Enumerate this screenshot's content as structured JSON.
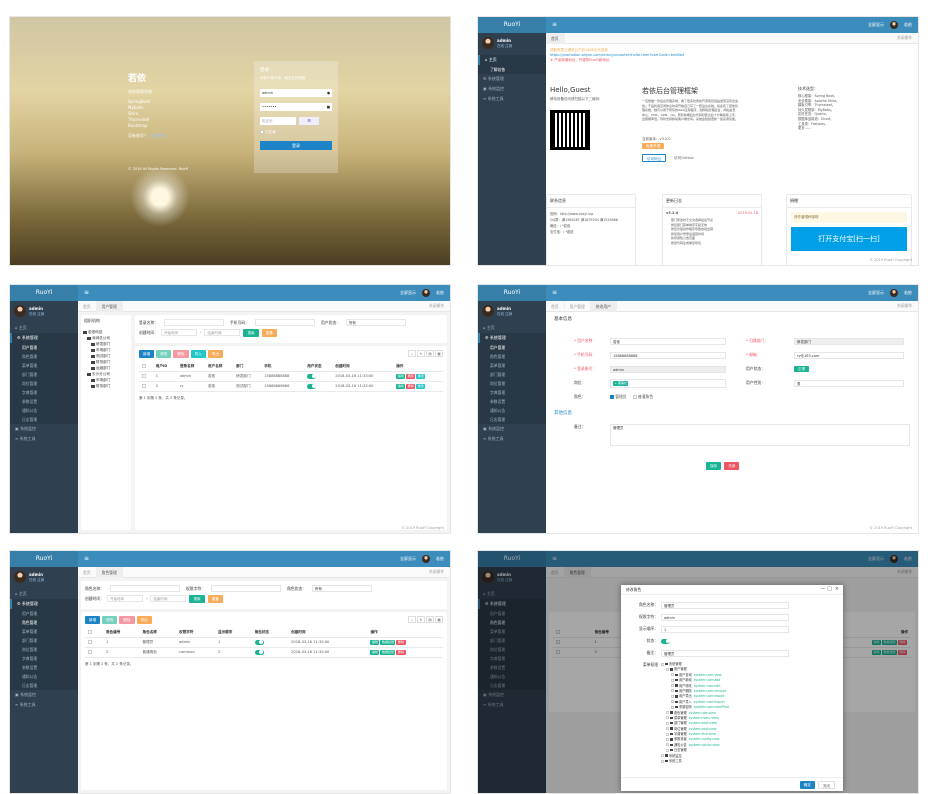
{
  "login": {
    "brand": "若依",
    "slogan": "若依管理系统",
    "features": [
      "SpringBoot",
      "Mybatis",
      "Shiro",
      "Thymeleaf",
      "Bootstrap"
    ],
    "register_hint": "没有账号？",
    "register_link": "立即注册",
    "login_title": "登录：",
    "login_subtitle": "你若不离不弃，我必生死相依",
    "username": "admin",
    "password": "•••••••",
    "captcha_placeholder": "验证码",
    "remember": "记住我",
    "login_button": "登录",
    "copyright": "© 2019 All Rights Reserved. RuoYi"
  },
  "common": {
    "logo": "RuoYi",
    "user": "admin",
    "online": "在线",
    "logout": "注销",
    "fullscreen": "全屏显示",
    "personal_center": "若依",
    "home_tab": "首页",
    "tab_actions": "关闭操作",
    "refresh": "刷新",
    "copyright": "© 2019 RuoYi Copyright",
    "menu_system": "系统管理",
    "menu_monitor": "系统监控",
    "menu_tool": "系统工具",
    "menu_home": "主页",
    "system_sub": [
      "用户管理",
      "角色管理",
      "菜单管理",
      "部门管理",
      "岗位管理",
      "字典管理",
      "参数设置",
      "通知公告",
      "日志管理"
    ]
  },
  "dashboard": {
    "menu_home_sub": "了解若依",
    "notice_line1": "领取阿里云通用云产品1888元代金券",
    "notice_line2": "https://promotion.aliyun.com/ntms/yunparter/invite.html?userCode=brki8iof",
    "notice_line3": "★ 产品新增地址，开源的RuoYi新地址",
    "hello": "Hello,Guest",
    "hello_sub": "移动设备访问请扫描以下二维码：",
    "title": "若依后台管理框架",
    "desc": "一直想做一款后台管理系统，看了很多优秀的开源项目但是发现没有合适的。于是利用空闲休息时间开始自己写了一套后台系统。如此有了若依管理系统，她可以用于所有的Web应用程序，如网站管理后台，网站会员中心，CMS，CRM，OA。所有前端后台代码封装过后十分精简易上手，出错概率低。同时支持移动客户端访问。系统会陆续更新一些实用功能。",
    "version_label": "当前版本：v3.2.0",
    "free_badge": "免费开源",
    "btn_cloud": "访问码云",
    "btn_github": "访问GitHub",
    "tech_title": "技术选型：",
    "tech": [
      "核心框架：Spring Boot。",
      "安全框架：Apache Shiro。",
      "模板引擎：Thymeleaf。",
      "持久层框架：MyBatis。",
      "定时任务：Quartz。",
      "数据库连接池：Druid。",
      "工具类：Fastjson。",
      "更多……"
    ],
    "contact_title": "联系信息",
    "contact": [
      "官网：http://www.ruoyi.vip",
      "QQ群：满1389287 满1679294 满1529866",
      "微信：/ *若依",
      "支付宝：/ *若依"
    ],
    "log_title": "更新日志",
    "log_version": "v3.2.0",
    "log_date": "2019.01.18",
    "log_items": [
      "部门修改时不允许选择最后节点",
      "修复部门菜单排序字段无效",
      "修复光驱动作程序导致启动出错",
      "修复用户登录后返回时间",
      "新增通知公告页面",
      "修复代码生成重复导包"
    ],
    "donate_title": "捐赠",
    "donate_hint": "请作者喝杯咖啡",
    "alipay": "打开支付宝[扫一扫]"
  },
  "user_list": {
    "tab": "用户管理",
    "tree_title": "组织机构",
    "tree": [
      "若依科技",
      "深圳总公司",
      "研发部门",
      "市场部门",
      "测试部门",
      "财务部门",
      "运维部门",
      "长沙分公司",
      "市场部门",
      "财务部门"
    ],
    "f_login": "登录名称：",
    "f_phone": "手机号码：",
    "f_status": "用户状态：",
    "f_status_val": "所有",
    "f_time": "创建时间：",
    "start_ph": "开始时间",
    "end_ph": "结束时间",
    "search": "搜索",
    "reset": "重置",
    "add": "新增",
    "edit": "修改",
    "delete": "删除",
    "import": "导入",
    "export": "导出",
    "columns": [
      "用户ID",
      "登录名称",
      "用户名称",
      "部门",
      "手机",
      "用户状态",
      "创建时间",
      "操作"
    ],
    "rows": [
      {
        "id": "1",
        "login": "admin",
        "name": "若依",
        "dept": "研发部门",
        "phone": "15888888888",
        "time": "2018-03-16 11:33:00"
      },
      {
        "id": "2",
        "login": "ry",
        "name": "若依",
        "dept": "测试部门",
        "phone": "15666666666",
        "time": "2018-03-16 11:33:00"
      }
    ],
    "row_actions": [
      "编辑",
      "删除",
      "重置"
    ],
    "pager": "第 1 到第 2 条，共 2 条记录。"
  },
  "user_edit": {
    "tab1": "用户管理",
    "tab2": "修改用户",
    "section1": "基本信息",
    "section2": "其他信息",
    "nickname_l": "* 用户名称：",
    "nickname": "若依",
    "dept_l": "* 归属部门：",
    "dept": "研发部门",
    "phone_l": "* 手机号码：",
    "phone": "15888888888",
    "email_l": "* 邮箱：",
    "email": "ry@163.com",
    "login_l": "* 登录账号：",
    "login": "admin",
    "status_l": "用户状态：",
    "status": "正常",
    "post_l": "岗位：",
    "post_btn": "+ 董事长",
    "sex_l": "用户性别：",
    "sex": "男",
    "role_l": "角色：",
    "roles": [
      "管理员",
      "普通角色"
    ],
    "remark_l": "备注：",
    "remark": "管理员",
    "save": "保存",
    "close": "关闭"
  },
  "role_list": {
    "tab": "角色管理",
    "f_name": "角色名称：",
    "f_key": "权限字符：",
    "f_status": "角色状态：",
    "f_status_val": "所有",
    "f_time": "创建时间：",
    "start_ph": "开始时间",
    "end_ph": "结束时间",
    "search": "搜索",
    "reset": "重置",
    "add": "新增",
    "edit": "修改",
    "delete": "删除",
    "export": "导出",
    "columns": [
      "角色编号",
      "角色名称",
      "权限字符",
      "显示顺序",
      "角色状态",
      "创建时间",
      "操作"
    ],
    "rows": [
      {
        "id": "1",
        "name": "管理员",
        "key": "admin",
        "sort": "1",
        "time": "2018-03-16 11:33:00"
      },
      {
        "id": "2",
        "name": "普通角色",
        "key": "common",
        "sort": "2",
        "time": "2018-03-16 11:33:00"
      }
    ],
    "row_actions": [
      "编辑",
      "数据权限",
      "删除"
    ],
    "pager": "第 1 到第 2 条，共 2 条记录。"
  },
  "role_modal": {
    "title": "修改角色",
    "name_l": "角色名称：",
    "name": "管理员",
    "key_l": "权限字符：",
    "key": "admin",
    "sort_l": "显示顺序：",
    "sort": "1",
    "status_l": "状态：",
    "remark_l": "备注：",
    "remark": "管理员",
    "perm_l": "菜单权限",
    "tree": [
      {
        "label": "系统管理",
        "perm": "",
        "level": 0
      },
      {
        "label": "用户管理",
        "perm": "",
        "level": 1
      },
      {
        "label": "用户查询",
        "perm": "system:user:view",
        "level": 2
      },
      {
        "label": "用户新增",
        "perm": "system:user:add",
        "level": 2
      },
      {
        "label": "用户修改",
        "perm": "system:user:edit",
        "level": 2
      },
      {
        "label": "用户删除",
        "perm": "system:user:remove",
        "level": 2
      },
      {
        "label": "用户导出",
        "perm": "system:user:export",
        "level": 2
      },
      {
        "label": "用户导入",
        "perm": "system:user:import",
        "level": 2
      },
      {
        "label": "重置密码",
        "perm": "system:user:resetPwd",
        "level": 2
      },
      {
        "label": "角色管理",
        "perm": "system:role:view",
        "level": 1
      },
      {
        "label": "菜单管理",
        "perm": "system:menu:view",
        "level": 1
      },
      {
        "label": "部门管理",
        "perm": "system:dept:view",
        "level": 1
      },
      {
        "label": "岗位管理",
        "perm": "system:post:view",
        "level": 1
      },
      {
        "label": "字典管理",
        "perm": "system:dict:view",
        "level": 1
      },
      {
        "label": "参数设置",
        "perm": "system:config:view",
        "level": 1
      },
      {
        "label": "通知公告",
        "perm": "system:notice:view",
        "level": 1
      },
      {
        "label": "日志管理",
        "perm": "",
        "level": 1
      },
      {
        "label": "系统监控",
        "perm": "",
        "level": 0
      },
      {
        "label": "系统工具",
        "perm": "",
        "level": 0
      }
    ],
    "ok": "确定",
    "cancel": "关闭"
  }
}
